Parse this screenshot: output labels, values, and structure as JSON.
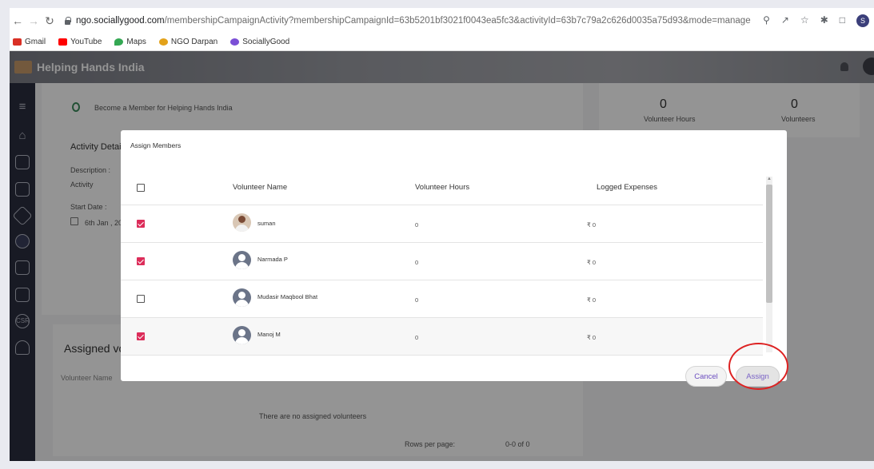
{
  "browser": {
    "url_host": "ngo.sociallygood.com",
    "url_path": "/membershipCampaignActivity?membershipCampaignId=63b5201bf3021f0043ea5fc3&activityId=63b7c79a2c626d0035a75d93&mode=manage",
    "bookmarks": [
      "Gmail",
      "YouTube",
      "Maps",
      "NGO Darpan",
      "SociallyGood"
    ],
    "profile_initial": "S"
  },
  "app": {
    "title": "Helping Hands India"
  },
  "background": {
    "campaign_label": "Become a Member for Helping Hands India",
    "activity_details": "Activity Details",
    "description_label": "Description :",
    "description_value": "Activity",
    "start_date_label": "Start Date :",
    "start_date_value": "6th Jan , 20",
    "stats": [
      {
        "value": "0",
        "label": "Volunteer Hours"
      },
      {
        "value": "0",
        "label": "Volunteers"
      }
    ],
    "assigned_title": "Assigned vol",
    "assigned_column": "Volunteer Name",
    "empty_message": "There are no assigned volunteers",
    "rows_per_page": "Rows per page:",
    "pagination": "0-0 of 0"
  },
  "modal": {
    "title": "Assign Members",
    "columns": [
      "Volunteer Name",
      "Volunteer Hours",
      "Logged Expenses"
    ],
    "rows": [
      {
        "name": "suman",
        "hours": "0",
        "expenses": "₹ 0",
        "checked": true
      },
      {
        "name": "Narmada P",
        "hours": "0",
        "expenses": "₹ 0",
        "checked": true
      },
      {
        "name": "Mudasir Maqbool Bhat",
        "hours": "0",
        "expenses": "₹ 0",
        "checked": false
      },
      {
        "name": "Manoj M",
        "hours": "0",
        "expenses": "₹ 0",
        "checked": true
      }
    ],
    "cancel_label": "Cancel",
    "assign_label": "Assign"
  },
  "colors": {
    "checkbox_checked": "#dc2d5a",
    "sidebar": "#2a2d3e",
    "annotation_circle": "#dd2222"
  }
}
